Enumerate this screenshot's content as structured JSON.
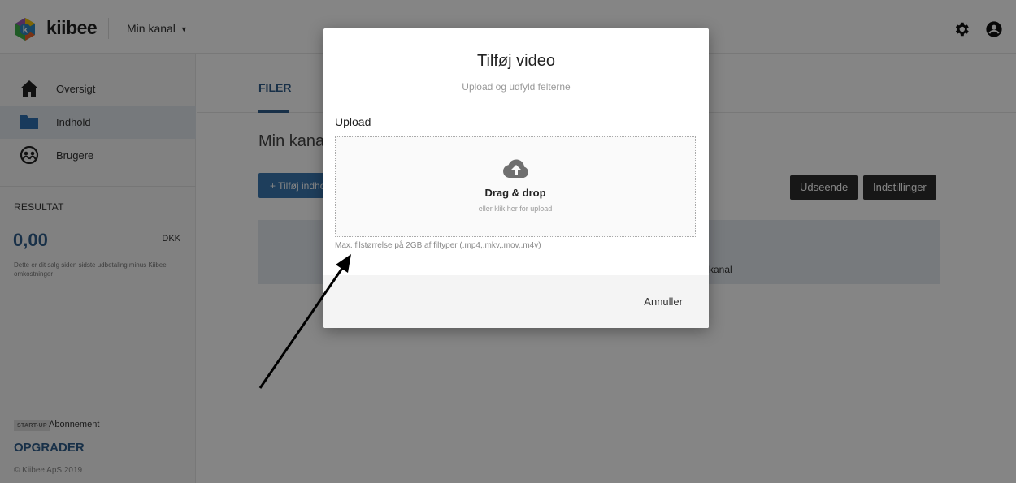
{
  "header": {
    "brand": "kiibee",
    "channel_select": "Min kanal"
  },
  "sidebar": {
    "items": [
      {
        "label": "Oversigt",
        "icon": "home-icon"
      },
      {
        "label": "Indhold",
        "icon": "folder-icon",
        "active": true
      },
      {
        "label": "Brugere",
        "icon": "users-icon"
      }
    ],
    "result": {
      "title": "RESULTAT",
      "value": "0,00",
      "currency": "DKK",
      "description": "Dette er dit salg siden sidste udbetaling minus Kiibee omkostninger"
    },
    "plan": {
      "badge": "START-UP",
      "label": "Abonnement",
      "upgrade": "OPGRADER"
    },
    "copyright": "© Kiibee ApS 2019"
  },
  "main": {
    "tab": "FILER",
    "title": "Min kanal",
    "add_button": "+ Tilføj indhold",
    "appearance_button": "Udseende",
    "settings_button": "Indstillinger",
    "info_text": "n kanal"
  },
  "modal": {
    "title": "Tilføj video",
    "subtitle": "Upload og udfyld felterne",
    "upload_label": "Upload",
    "drop_title": "Drag & drop",
    "drop_sub": "eller klik her for upload",
    "hint": "Max. filstørrelse på 2GB af filtyper (.mp4,.mkv,.mov,.m4v)",
    "cancel": "Annuller"
  },
  "colors": {
    "accent": "#2f5d8a",
    "button_blue": "#3a78b0",
    "dark_button": "#2d2d2d",
    "overlay": "rgba(0,0,0,0.48)"
  }
}
